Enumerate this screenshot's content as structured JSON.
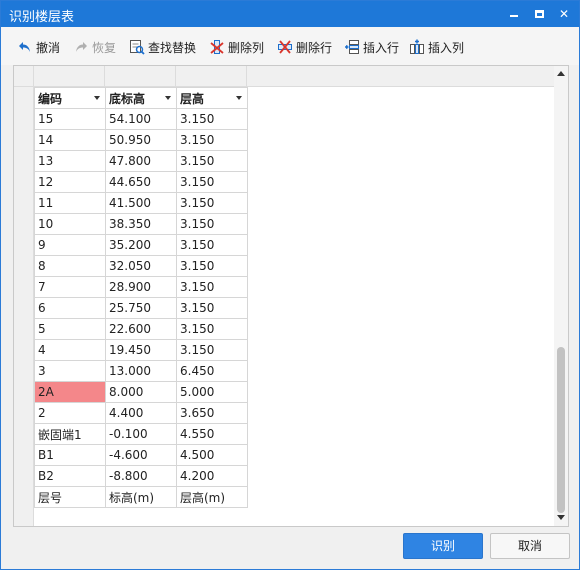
{
  "window": {
    "title": "识别楼层表"
  },
  "toolbar": {
    "undo": "撤消",
    "redo": "恢复",
    "find_replace": "查找替换",
    "delete_col": "删除列",
    "delete_row": "删除行",
    "insert_row": "插入行",
    "insert_col": "插入列"
  },
  "table": {
    "headers": [
      "编码",
      "底标高",
      "层高"
    ],
    "rows": [
      [
        "15",
        "54.100",
        "3.150"
      ],
      [
        "14",
        "50.950",
        "3.150"
      ],
      [
        "13",
        "47.800",
        "3.150"
      ],
      [
        "12",
        "44.650",
        "3.150"
      ],
      [
        "11",
        "41.500",
        "3.150"
      ],
      [
        "10",
        "38.350",
        "3.150"
      ],
      [
        "9",
        "35.200",
        "3.150"
      ],
      [
        "8",
        "32.050",
        "3.150"
      ],
      [
        "7",
        "28.900",
        "3.150"
      ],
      [
        "6",
        "25.750",
        "3.150"
      ],
      [
        "5",
        "22.600",
        "3.150"
      ],
      [
        "4",
        "19.450",
        "3.150"
      ],
      [
        "3",
        "13.000",
        "6.450"
      ],
      [
        "2A",
        "8.000",
        "5.000"
      ],
      [
        "2",
        "4.400",
        "3.650"
      ],
      [
        "嵌固端1",
        "-0.100",
        "4.550"
      ],
      [
        "B1",
        "-4.600",
        "4.500"
      ],
      [
        "B2",
        "-8.800",
        "4.200"
      ],
      [
        "层号",
        "标高(m)",
        "层高(m)"
      ]
    ],
    "highlight_color": "#f4878a"
  },
  "buttons": {
    "recognize": "识别",
    "cancel": "取消"
  },
  "colors": {
    "titlebar": "#1e78d8",
    "primary_button": "#2f84e3"
  }
}
